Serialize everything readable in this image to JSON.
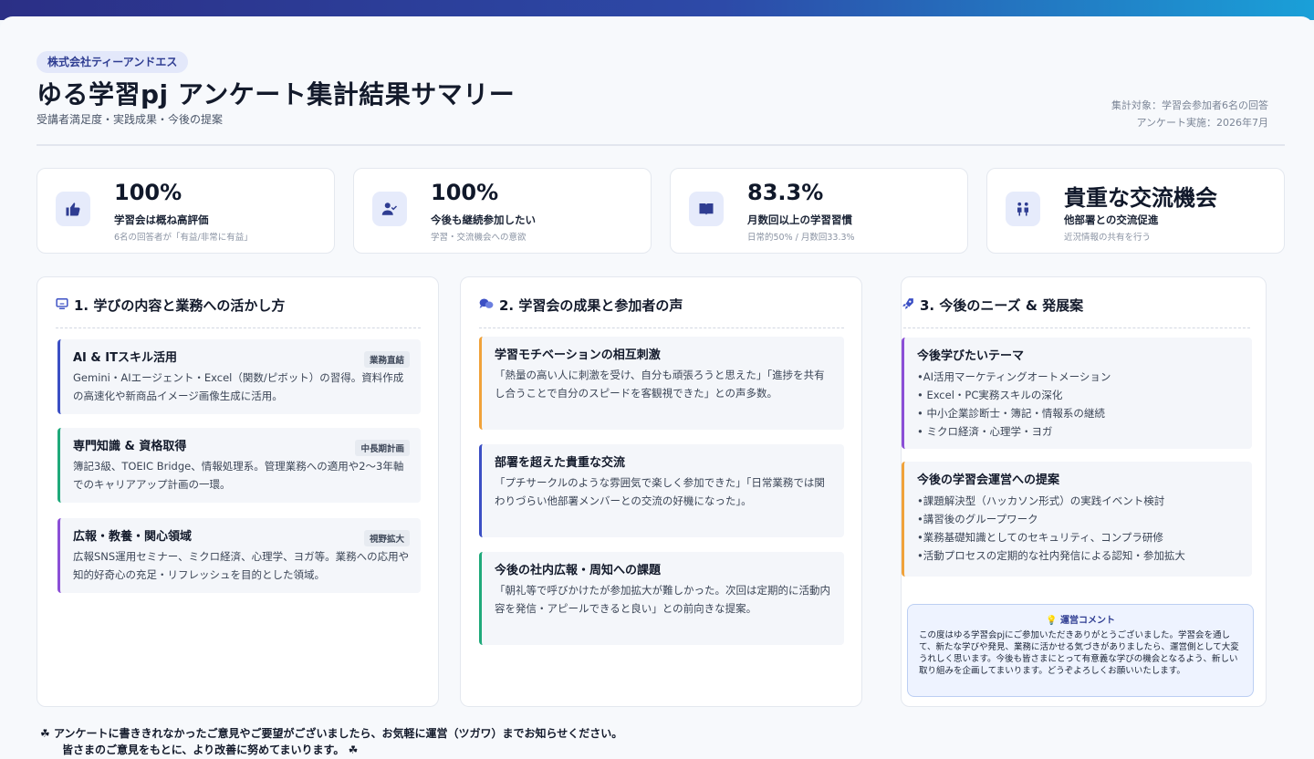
{
  "header": {
    "company": "株式会社ティーアンドエス",
    "title": "ゆる学習pj アンケート集計結果サマリー",
    "subtitle": "受講者満足度・実践成果・今後の提案",
    "meta_target": "集計対象：学習会参加者6名の回答",
    "meta_date": "アンケート実施：2026年7月"
  },
  "kpis": [
    {
      "icon": "thumbs-up-icon",
      "value": "100%",
      "label": "学習会は概ね高評価",
      "sub": "6名の回答者が「有益/非常に有益」"
    },
    {
      "icon": "user-check-icon",
      "value": "100%",
      "label": "今後も継続参加したい",
      "sub": "学習・交流機会への意欲"
    },
    {
      "icon": "book-icon",
      "value": "83.3%",
      "label": "月数回以上の学習習慣",
      "sub": "日常的50% / 月数回33.3%"
    },
    {
      "icon": "people-icon",
      "value": "貴重な交流機会",
      "label": "他部署との交流促進",
      "sub": "近況情報の共有を行う"
    }
  ],
  "col1": {
    "title": "1. 学びの内容と業務への活かし方",
    "items": [
      {
        "title": "AI & ITスキル活用",
        "tag": "業務直結",
        "color": "#3b4fc4",
        "text": "Gemini・AIエージェント・Excel（関数/ピボット）の習得。資料作成の高速化や新商品イメージ画像生成に活用。"
      },
      {
        "title": "専門知識 & 資格取得",
        "tag": "中長期計画",
        "color": "#1fa97a",
        "text": "簿記3級、TOEIC Bridge、情報処理系。管理業務への適用や2〜3年軸でのキャリアアップ計画の一環。"
      },
      {
        "title": "広報・教養・関心領域",
        "tag": "視野拡大",
        "color": "#8b4fd6",
        "text": "広報SNS運用セミナー、ミクロ経済、心理学、ヨガ等。業務への応用や知的好奇心の充足・リフレッシュを目的とした領域。"
      }
    ]
  },
  "col2": {
    "title": "2. 学習会の成果と参加者の声",
    "items": [
      {
        "title": "学習モチベーションの相互刺激",
        "color": "#f0a23a",
        "text": "「熱量の高い人に刺激を受け、自分も頑張ろうと思えた」「進捗を共有し合うことで自分のスピードを客観視できた」との声多数。"
      },
      {
        "title": "部署を超えた貴重な交流",
        "color": "#3b4fc4",
        "text": "「プチサークルのような雰囲気で楽しく参加できた」「日常業務では関わりづらい他部署メンバーとの交流の好機になった」。"
      },
      {
        "title": "今後の社内広報・周知への課題",
        "color": "#1fa97a",
        "text": "「朝礼等で呼びかけたが参加拡大が難しかった。次回は定期的に活動内容を発信・アピールできると良い」との前向きな提案。"
      }
    ]
  },
  "col3": {
    "title": "3. 今後のニーズ & 発展案",
    "themes_title": "今後学びたいテーマ",
    "themes": [
      "•AI活用マーケティングオートメーション",
      "• Excel・PC実務スキルの深化",
      "• 中小企業診断士・簿記・情報系の継続",
      "• ミクロ経済・心理学・ヨガ"
    ],
    "proposals_title": "今後の学習会運営への提案",
    "proposals": [
      "•課題解決型（ハッカソン形式）の実践イベント検討",
      "•講習後のグループワーク",
      "•業務基礎知識としてのセキュリティ、コンプラ研修",
      "•活動プロセスの定期的な社内発信による認知・参加拡大"
    ],
    "comment_title": "運営コメント",
    "comment_text": "この度はゆる学習会pjにご参加いただきありがとうございました。学習会を通して、新たな学びや発見、業務に活かせる気づきがありましたら、運営側として大変うれしく思います。今後も皆さまにとって有意義な学びの機会となるよう、新しい取り組みを企画してまいります。どうぞよろしくお願いいたします。"
  },
  "footer": {
    "line1": "アンケートに書ききれなかったご意見やご要望がございましたら、お気軽に運営（ツガワ）までお知らせください。",
    "line2": "皆さまのご意見をもとに、より改善に努めてまいります。"
  },
  "colors": {
    "accent": "#2f3d92",
    "green": "#1fa97a",
    "orange": "#f0a23a",
    "purple": "#8b4fd6"
  }
}
